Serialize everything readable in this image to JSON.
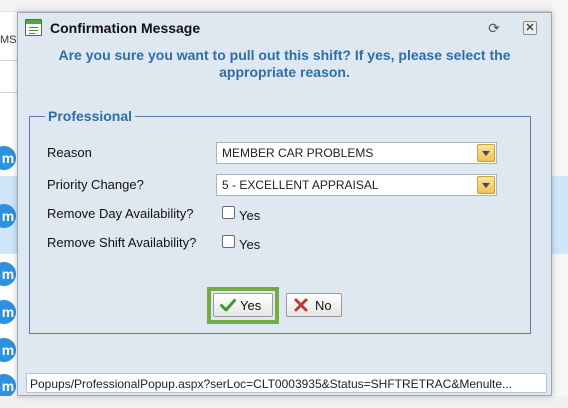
{
  "background": {
    "ms_text": "MS",
    "avatar_letter": "m"
  },
  "dialog": {
    "title": "Confirmation Message",
    "question": "Are you sure you want to pull out this shift? If yes, please select the appropriate reason.",
    "section_legend": "Professional",
    "fields": {
      "reason_label": "Reason",
      "reason_value": "MEMBER  CAR PROBLEMS",
      "priority_label": "Priority Change?",
      "priority_value": "5 - EXCELLENT APPRAISAL",
      "remove_day_label": "Remove Day Availability?",
      "remove_day_checkbox_text": "Yes",
      "remove_shift_label": "Remove Shift Availability?",
      "remove_shift_checkbox_text": "Yes"
    },
    "buttons": {
      "yes_label": "Yes",
      "no_label": "No"
    },
    "status_url": "Popups/ProfessionalPopup.aspx?serLoc=CLT0003935&Status=SHFTRETRAC&Menulte..."
  },
  "colors": {
    "accent_text": "#2c6ea8",
    "dialog_bg": "#dfe8f1",
    "highlight_frame": "#72ac42",
    "avatar": "#2f8fe0"
  },
  "icons": {
    "title": "message-window-icon",
    "refresh": "refresh-icon",
    "close": "close-icon",
    "yes": "checkmark-icon",
    "no": "x-icon"
  }
}
